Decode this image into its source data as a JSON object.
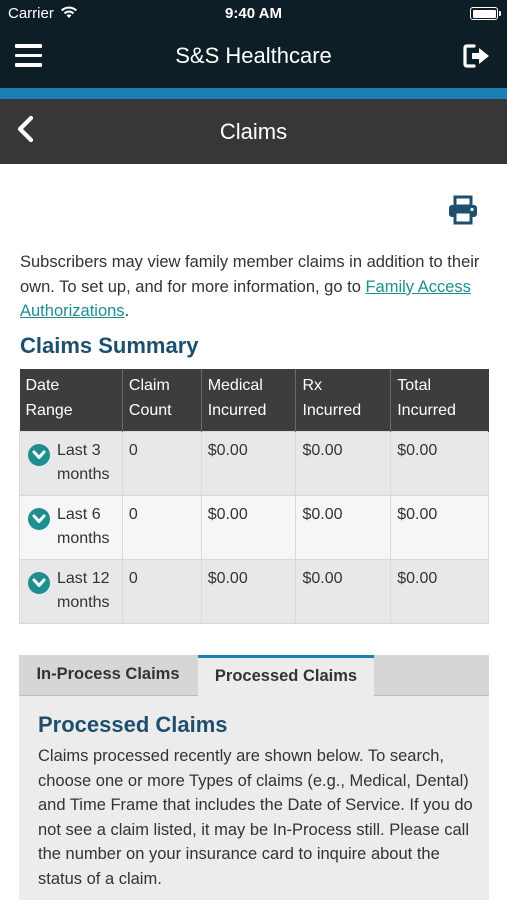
{
  "status_bar": {
    "carrier": "Carrier",
    "time": "9:40 AM",
    "icons": [
      "wifi-icon",
      "battery-icon"
    ]
  },
  "header": {
    "title": "S&S Healthcare",
    "menu_icon": "hamburger-menu-icon",
    "logout_icon": "logout-icon"
  },
  "sub_header": {
    "title": "Claims",
    "back_icon": "chevron-left-icon"
  },
  "print_icon": "printer-icon",
  "intro": {
    "text": "Subscribers may view family member claims in addition to their own. To set up, and for more information, go to ",
    "link_text": "Family Access Authorizations",
    "suffix": "."
  },
  "summary": {
    "title": "Claims Summary",
    "columns": [
      {
        "line1": "Date",
        "line2": "Range"
      },
      {
        "line1": "Claim",
        "line2": "Count"
      },
      {
        "line1": "Medical",
        "line2": "Incurred"
      },
      {
        "line1": "Rx",
        "line2": "Incurred"
      },
      {
        "line1": "Total",
        "line2": "Incurred"
      }
    ],
    "rows": [
      {
        "range_line1": "Last 3",
        "range_line2": "months",
        "count": "0",
        "medical": "$0.00",
        "rx": "$0.00",
        "total": "$0.00"
      },
      {
        "range_line1": "Last 6",
        "range_line2": "months",
        "count": "0",
        "medical": "$0.00",
        "rx": "$0.00",
        "total": "$0.00"
      },
      {
        "range_line1": "Last 12",
        "range_line2": "months",
        "count": "0",
        "medical": "$0.00",
        "rx": "$0.00",
        "total": "$0.00"
      }
    ]
  },
  "tabs": {
    "in_process": "In-Process Claims",
    "processed": "Processed Claims",
    "active": "processed"
  },
  "panel": {
    "title": "Processed Claims",
    "text": "Claims processed recently are shown below. To search, choose one or more Types of claims (e.g., Medical, Dental) and Time Frame that includes the Date of Service. If you do not see a claim listed, it may be In-Process still. Please call the number on your insurance card to inquire about the status of a claim."
  },
  "colors": {
    "header_bg": "#0d1e27",
    "accent_stripe": "#1b7fb3",
    "sub_header_bg": "#373737",
    "heading": "#1e4f6e",
    "link": "#1f8e8e",
    "chevron_badge": "#1f8e8e"
  }
}
